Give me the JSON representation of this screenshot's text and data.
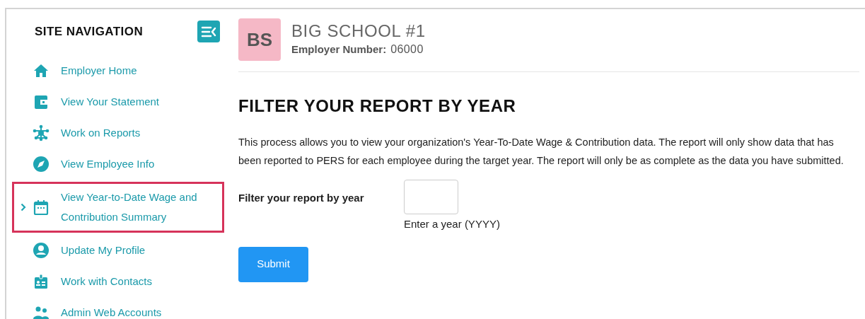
{
  "sidebar": {
    "title": "SITE NAVIGATION",
    "items": [
      {
        "label": "Employer Home",
        "selected": false
      },
      {
        "label": "View Your Statement",
        "selected": false
      },
      {
        "label": "Work on Reports",
        "selected": false
      },
      {
        "label": "View Employee Info",
        "selected": false
      },
      {
        "label": "View Year-to-Date Wage and Contribution Summary",
        "selected": true
      },
      {
        "label": "Update My Profile",
        "selected": false
      },
      {
        "label": "Work with Contacts",
        "selected": false
      },
      {
        "label": "Admin Web Accounts",
        "selected": false
      }
    ]
  },
  "header": {
    "initials": "BS",
    "name": "BIG SCHOOL #1",
    "employer_number_label": "Employer Number:",
    "employer_number": "06000"
  },
  "content": {
    "heading": "FILTER YOUR REPORT BY YEAR",
    "description": "This process allows you to view your organization's Year-To-Date Wage & Contribution data. The report will only show data that has been reported to PERS for each employee during the target year. The report will only be as complete as the data you have submitted.",
    "filter_label": "Filter your report by year",
    "hint": "Enter a year (YYYY)",
    "submit": "Submit"
  }
}
